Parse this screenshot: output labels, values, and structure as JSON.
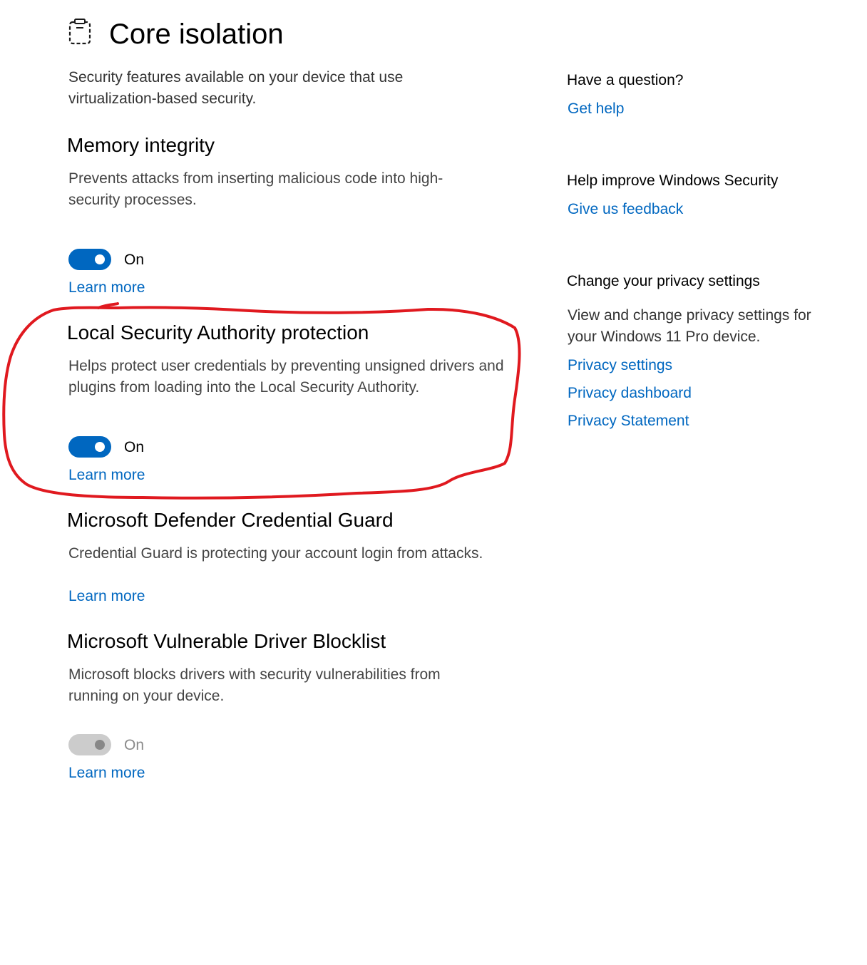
{
  "page": {
    "icon": "core-isolation-icon",
    "title": "Core isolation",
    "description": "Security features available on your device that use virtualization-based security."
  },
  "sections": [
    {
      "title": "Memory integrity",
      "description": "Prevents attacks from inserting malicious code into high-security processes.",
      "toggle": {
        "state": "on",
        "label": "On",
        "enabled": true
      },
      "link": "Learn more"
    },
    {
      "title": "Local Security Authority protection",
      "description": "Helps protect user credentials by preventing unsigned drivers and plugins from loading into the Local Security Authority.",
      "toggle": {
        "state": "on",
        "label": "On",
        "enabled": true
      },
      "link": "Learn more"
    },
    {
      "title": "Microsoft Defender Credential Guard",
      "description": "Credential Guard is protecting your account login from attacks.",
      "link": "Learn more"
    },
    {
      "title": "Microsoft Vulnerable Driver Blocklist",
      "description": "Microsoft blocks drivers with security vulnerabilities from running on your device.",
      "toggle": {
        "state": "on",
        "label": "On",
        "enabled": false
      },
      "link": "Learn more"
    }
  ],
  "sidebar": {
    "question": {
      "heading": "Have a question?",
      "link": "Get help"
    },
    "improve": {
      "heading": "Help improve Windows Security",
      "link": "Give us feedback"
    },
    "privacy": {
      "heading": "Change your privacy settings",
      "text": "View and change privacy settings for your Windows 11 Pro device.",
      "links": [
        "Privacy settings",
        "Privacy dashboard",
        "Privacy Statement"
      ]
    }
  },
  "colors": {
    "accent": "#0067c0",
    "annotation": "#e0191f",
    "toggle_disabled": "#cccccc"
  },
  "annotation": {
    "shape": "freehand-circle",
    "target": "Local Security Authority protection"
  }
}
